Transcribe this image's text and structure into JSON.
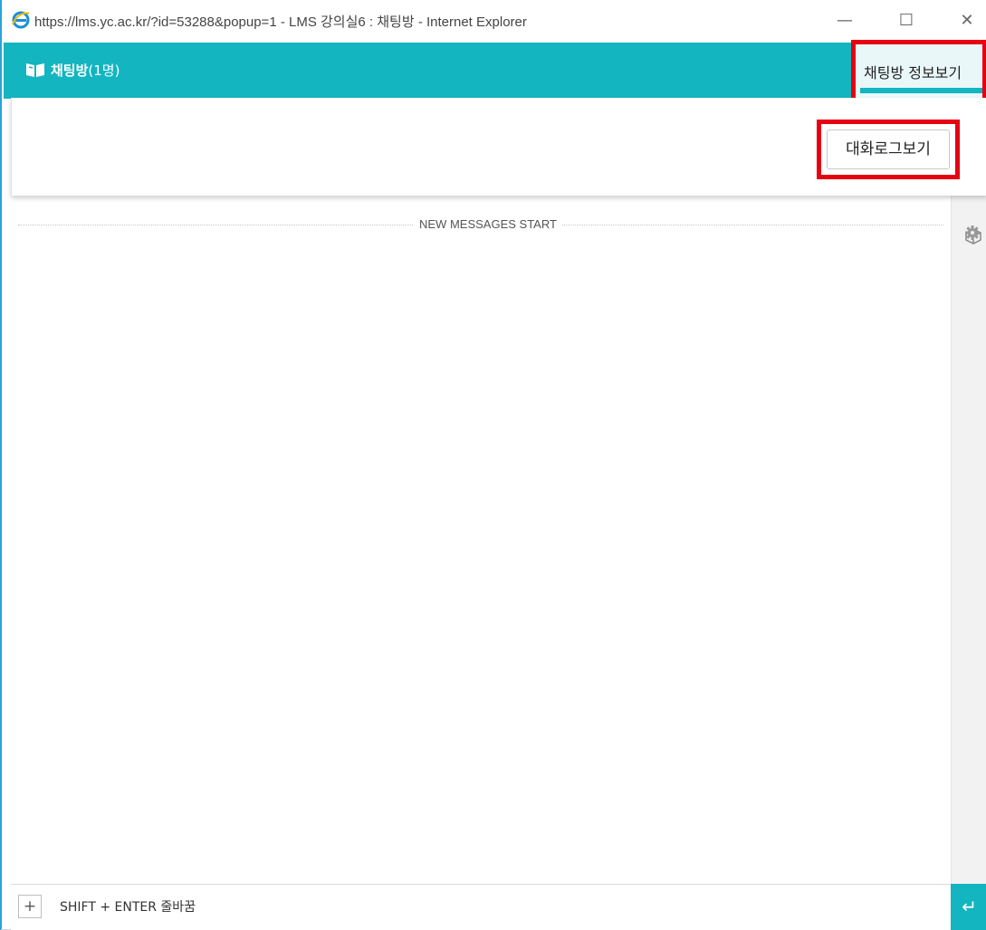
{
  "window": {
    "title": "https://lms.yc.ac.kr/?id=53288&popup=1 - LMS 강의실6 : 채팅방 - Internet Explorer",
    "minimize": "—",
    "maximize": "☐",
    "close": "✕"
  },
  "header": {
    "room_title": "채팅방",
    "member_count": "(1명)",
    "info_button": "채팅방 정보보기",
    "accent_color": "#13b5c0",
    "highlight_color": "#e60012"
  },
  "dropdown": {
    "log_button": "대화로그보기"
  },
  "messages": {
    "new_messages_label": "NEW MESSAGES START"
  },
  "side_rail": {
    "icons": [
      "cube-icon",
      "gear-icon"
    ]
  },
  "input": {
    "add_button": "+",
    "placeholder": "SHIFT + ENTER 줄바꿈",
    "send_icon": "↵"
  }
}
